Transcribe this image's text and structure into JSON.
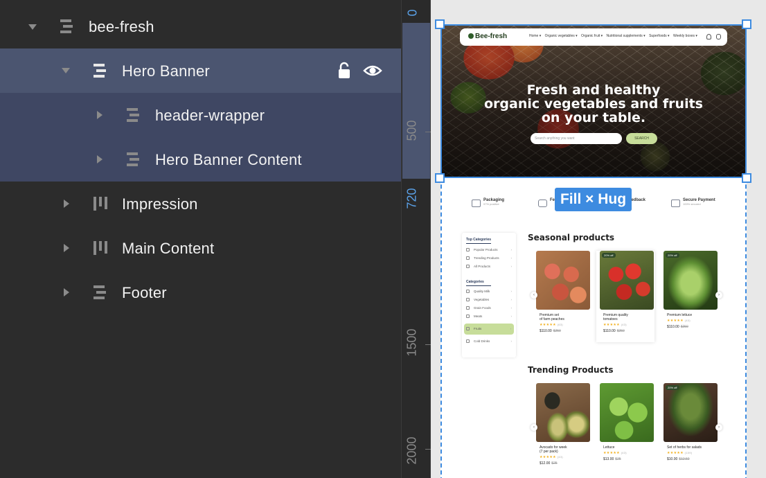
{
  "layers": {
    "root": {
      "name": "bee-fresh"
    },
    "hero_banner": {
      "name": "Hero Banner"
    },
    "header_wrapper": {
      "name": "header-wrapper"
    },
    "hero_content": {
      "name": "Hero Banner Content"
    },
    "impression": {
      "name": "Impression"
    },
    "main_content": {
      "name": "Main Content"
    },
    "footer": {
      "name": "Footer"
    }
  },
  "ruler": {
    "labels": [
      "0",
      "500",
      "720",
      "1500",
      "2000"
    ]
  },
  "selection": {
    "size_label": "Fill × Hug",
    "color": "#3d8be0"
  },
  "site": {
    "logo": "Bee-fresh",
    "nav": [
      "Home ▾",
      "Organic vegetables ▾",
      "Organic fruit ▾",
      "Nutritional supplements ▾",
      "Superfoods ▾",
      "Weekly boxes ▾"
    ],
    "hero_title_lines": [
      "Fresh and healthy",
      "organic vegetables and fruits",
      "on your table."
    ],
    "search_placeholder": "Search anything you want",
    "search_button": "SEARCH",
    "features": [
      {
        "title": "Packaging",
        "sub": "97% positive"
      },
      {
        "title": "Fe",
        "sub": ""
      },
      {
        "title": "feedback",
        "sub": ""
      },
      {
        "title": "Secure Payment",
        "sub": "100% secured"
      }
    ],
    "sidebar": {
      "top_title": "Top Categories",
      "top_items": [
        "Popular Products",
        "Trending Products",
        "All Products"
      ],
      "cat_title": "Categories",
      "cat_items": [
        "Quality Milk",
        "Vegetables",
        "Grain Foods",
        "Meats",
        "Fruits",
        "Cold Drinks"
      ]
    },
    "seasonal_title": "Seasonal products",
    "trending_title": "Trending Products",
    "seasonal": [
      {
        "name": "Premium set\nof farm peaches",
        "rating": "(63)",
        "price": "$110.00",
        "old": "$250",
        "badge": ""
      },
      {
        "name": "Premium quality\ntomatoes",
        "rating": "(43)",
        "price": "$110.00",
        "old": "$250",
        "badge": "20% off"
      },
      {
        "name": "Premium lettuce",
        "rating": "(40)",
        "price": "$110.00",
        "old": "$250",
        "badge": "20% off"
      }
    ],
    "trending": [
      {
        "name": "Avocado for week\n(7 per pack)",
        "rating": "(43)",
        "price": "$12.00",
        "old": "$25",
        "badge": ""
      },
      {
        "name": "Lettuce",
        "rating": "(43)",
        "price": "$13.00",
        "old": "$25",
        "badge": ""
      },
      {
        "name": "Set of herbs for salads",
        "rating": "(109)",
        "price": "$10.00",
        "old": "$12.50",
        "badge": "20% off"
      }
    ],
    "stars": "★★★★★"
  }
}
